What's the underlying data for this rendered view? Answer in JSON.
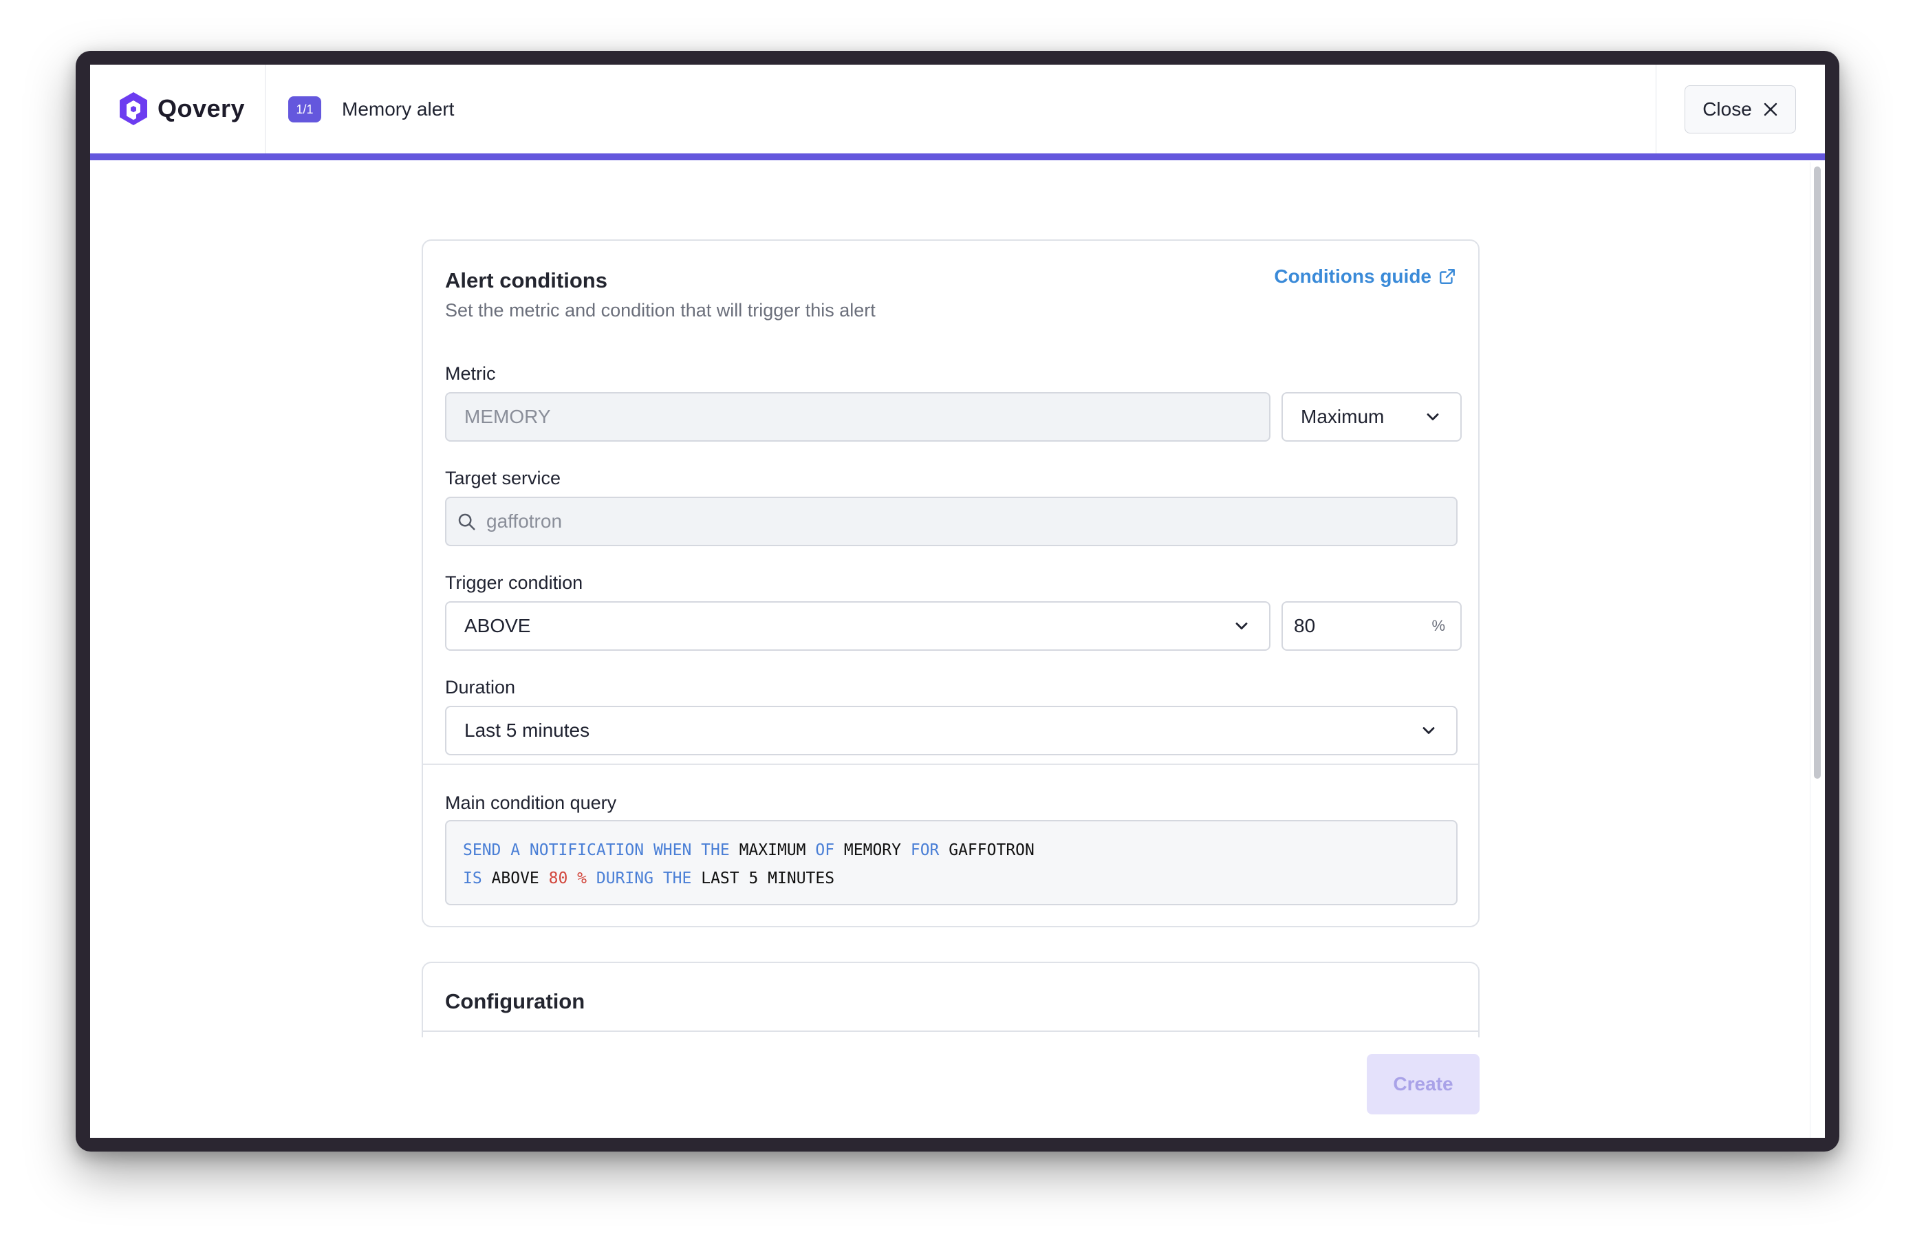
{
  "header": {
    "brand": "Qovery",
    "step_badge": "1/1",
    "step_title": "Memory alert",
    "close_label": "Close"
  },
  "alert_conditions": {
    "title": "Alert conditions",
    "subtitle": "Set the metric and condition that will trigger this alert",
    "guide_link": "Conditions guide",
    "metric": {
      "label": "Metric",
      "value": "MEMORY",
      "aggregation": "Maximum"
    },
    "target_service": {
      "label": "Target service",
      "value": "gaffotron"
    },
    "trigger_condition": {
      "label": "Trigger condition",
      "operator": "ABOVE",
      "threshold": "80",
      "unit": "%"
    },
    "duration": {
      "label": "Duration",
      "value": "Last 5 minutes"
    },
    "query": {
      "label": "Main condition query",
      "line1": [
        {
          "t": "SEND A NOTIFICATION WHEN THE ",
          "k": "kw"
        },
        {
          "t": "MAXIMUM ",
          "k": "val"
        },
        {
          "t": "OF ",
          "k": "kw"
        },
        {
          "t": "MEMORY ",
          "k": "val"
        },
        {
          "t": "FOR ",
          "k": "kw"
        },
        {
          "t": "GAFFOTRON",
          "k": "val"
        }
      ],
      "line2": [
        {
          "t": "IS ",
          "k": "kw"
        },
        {
          "t": "ABOVE ",
          "k": "val"
        },
        {
          "t": "80 % ",
          "k": "num"
        },
        {
          "t": "DURING THE ",
          "k": "kw"
        },
        {
          "t": "LAST 5 MINUTES",
          "k": "val"
        }
      ]
    }
  },
  "configuration": {
    "title": "Configuration"
  },
  "footer": {
    "create_label": "Create"
  },
  "colors": {
    "accent": "#6457dd",
    "link": "#3a8ad8",
    "keyword": "#4a7fd6",
    "number": "#d2453b",
    "create_disabled_bg": "#e4e1fb"
  }
}
